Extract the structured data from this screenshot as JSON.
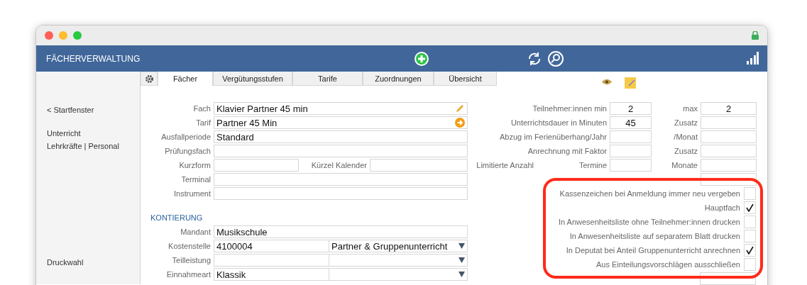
{
  "header": {
    "title": "FÄCHERVERWALTUNG"
  },
  "sidebar": {
    "back": "< Startfenster",
    "links": [
      "Unterricht",
      "Lehrkräfte | Personal"
    ],
    "footer": "Druckwahl"
  },
  "tabs": [
    {
      "label": "Fächer",
      "selected": true
    },
    {
      "label": "Vergütungsstufen",
      "selected": false
    },
    {
      "label": "Tarife",
      "selected": false
    },
    {
      "label": "Zuordnungen",
      "selected": false
    },
    {
      "label": "Übersicht",
      "selected": false
    }
  ],
  "left_form": {
    "fields": [
      {
        "kind": "edit",
        "label": "Fach",
        "value": "Klavier Partner 45 min"
      },
      {
        "kind": "link",
        "label": "Tarif",
        "value": "Partner 45 Min"
      },
      {
        "kind": "text",
        "label": "Ausfallperiode",
        "value": "Standard"
      },
      {
        "kind": "text",
        "label": "Prüfungsfach"
      },
      {
        "kind": "pair",
        "label": "Kurzform",
        "label2": "Kürzel Kalender"
      },
      {
        "kind": "text",
        "label": "Terminal"
      },
      {
        "kind": "text",
        "label": "Instrument"
      }
    ],
    "section": "KONTIERUNG",
    "accounting": [
      {
        "kind": "text",
        "label": "Mandant",
        "value": "Musikschule"
      },
      {
        "kind": "select",
        "label": "Kostenstelle",
        "value": "4100004",
        "option": "Partner & Gruppenunterricht"
      },
      {
        "kind": "select",
        "label": "Teilleistung"
      },
      {
        "kind": "select",
        "label": "Einnahmeart",
        "value": "Klassik"
      }
    ]
  },
  "right_form": {
    "rows": [
      {
        "kind": "both",
        "label": "Teilnehmer:innen min",
        "value": "2",
        "label2": "max",
        "value2": "2"
      },
      {
        "kind": "both",
        "label": "Unterrichtsdauer in Minuten",
        "value": "45",
        "label2": "Zusatz"
      },
      {
        "kind": "both",
        "label": "Abzug im Ferienüberhang/Jahr",
        "label2": "/Monat"
      },
      {
        "kind": "both",
        "label": "Anrechnung mit Faktor",
        "label2": "Zusatz"
      },
      {
        "kind": "split",
        "label": "Limitierte Anzahl",
        "sublabel": "Termine",
        "label2": "Monate"
      },
      {
        "kind": "right"
      }
    ],
    "checkboxes": [
      {
        "label": "Kassenzeichen bei Anmeldung immer neu vergeben",
        "checked": false
      },
      {
        "label": "Hauptfach",
        "checked": true
      },
      {
        "label": "In Anwesenheitsliste ohne Teilnehmer:innen drucken",
        "checked": false
      },
      {
        "label": "In Anwesenheitsliste auf separatem Blatt drucken",
        "checked": false
      },
      {
        "label": "In Deputat bei Anteil Gruppenunterricht anrechnen",
        "checked": true
      },
      {
        "label": "Aus Einteilungsvorschlägen ausschließen",
        "checked": false
      }
    ],
    "last": {
      "kind": "field"
    }
  }
}
